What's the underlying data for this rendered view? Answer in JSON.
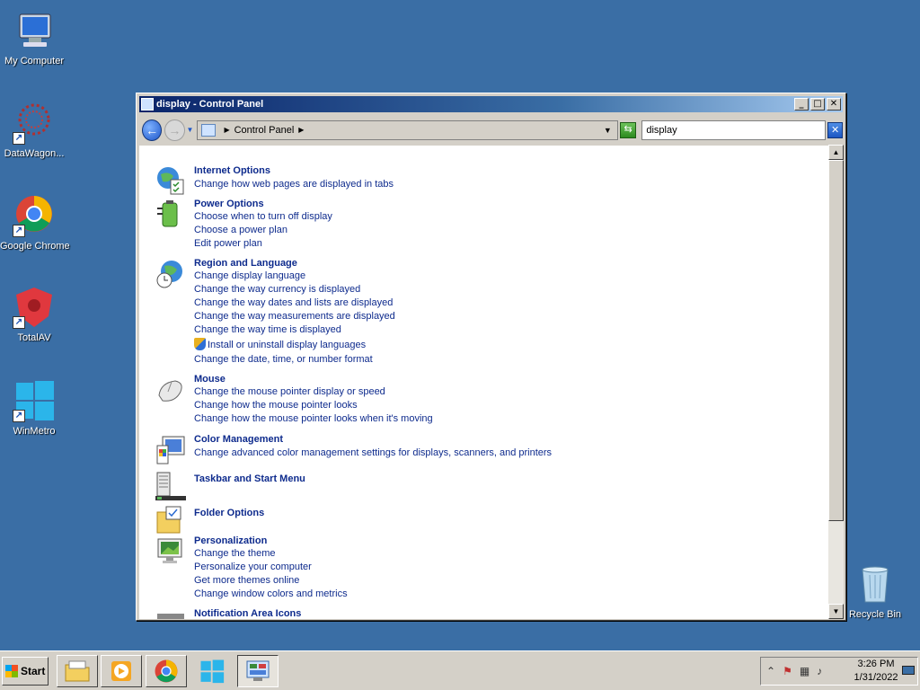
{
  "desktop": {
    "icons": [
      {
        "label": "My Computer",
        "icon": "my-computer-icon"
      },
      {
        "label": "DataWagon...",
        "icon": "datawagon-icon"
      },
      {
        "label": "Google Chrome",
        "icon": "chrome-icon"
      },
      {
        "label": "TotalAV",
        "icon": "totalav-icon"
      },
      {
        "label": "WinMetro",
        "icon": "winmetro-icon"
      },
      {
        "label": "Recycle Bin",
        "icon": "recycle-bin-icon"
      }
    ]
  },
  "window": {
    "title": "display - Control Panel",
    "address": {
      "breadcrumb": "Control Panel"
    },
    "search": {
      "value": "display"
    },
    "categories": [
      {
        "title": "Internet Options",
        "links": [
          "Change how web pages are displayed in tabs"
        ]
      },
      {
        "title": "Power Options",
        "links": [
          "Choose when to turn off display",
          "Choose a power plan",
          "Edit power plan"
        ]
      },
      {
        "title": "Region and Language",
        "links": [
          "Change display language",
          "Change the way currency is displayed",
          "Change the way dates and lists are displayed",
          "Change the way measurements are displayed",
          "Change the way time is displayed",
          "Install or uninstall display languages",
          "Change the date, time, or number format"
        ]
      },
      {
        "title": "Mouse",
        "links": [
          "Change the mouse pointer display or speed",
          "Change how the mouse pointer looks",
          "Change how the mouse pointer looks when it's moving"
        ]
      },
      {
        "title": "Color Management",
        "links": [
          "Change advanced color management settings for displays, scanners, and printers"
        ]
      },
      {
        "title": "Taskbar and Start Menu",
        "links": []
      },
      {
        "title": "Folder Options",
        "links": []
      },
      {
        "title": "Personalization",
        "links": [
          "Change the theme",
          "Personalize your computer",
          "Get more themes online",
          "Change window colors and metrics"
        ]
      },
      {
        "title": "Notification Area Icons",
        "links": []
      }
    ]
  },
  "taskbar": {
    "start_label": "Start",
    "clock_time": "3:26 PM",
    "clock_date": "1/31/2022"
  },
  "colors": {
    "desktop": "#3a6ea5",
    "link": "#0e2b8d"
  }
}
